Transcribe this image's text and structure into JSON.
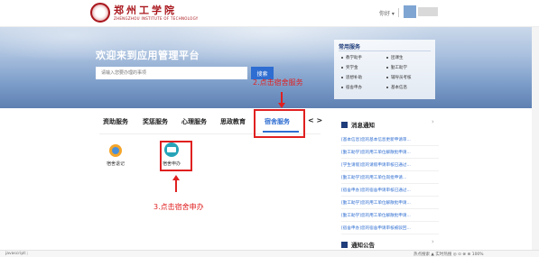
{
  "header": {
    "logo_cn": "郑州工学院",
    "logo_en": "ZHENGZHOU INSTITUTE OF TECHNOLOGY",
    "user_label": "你好 ▾"
  },
  "banner": {
    "title": "欢迎来到应用管理平台",
    "search_placeholder": "请输入您要办理的事项",
    "search_button": "搜索"
  },
  "quick": {
    "title": "常用服务",
    "items": [
      "教学助手",
      "团课生",
      "奖学金",
      "勤工助学",
      "思想补助",
      "辅导员考核",
      "宿舍申办",
      "基本信息"
    ]
  },
  "annotations": {
    "step2": "2.点击宿舍服务",
    "step3": "3.点击宿舍申办"
  },
  "tabs": {
    "items": [
      "资助服务",
      "奖惩服务",
      "心理服务",
      "思政教育",
      "宿舍服务"
    ],
    "active_index": 4,
    "arrows": "< >"
  },
  "services": [
    {
      "label": "宿舍退记"
    },
    {
      "label": "宿舍申办"
    }
  ],
  "notice": {
    "title": "消息通知",
    "more": "›",
    "items": [
      "[基本信息]您的基本信息更新申请审...",
      "[勤工助学]您的用工单位解散批申请...",
      "[学生请假]您的请假申请审核已通过...",
      "[勤工助学]您的用工单位岗批申请...",
      "[宿舍申办]您的宿舍申请审核已通过...",
      "[勤工助学]您的用工单位解散批申请...",
      "[勤工助学]您的用工单位解散批申请...",
      "[宿舍申办]您的宿舍申请审核被驳回..."
    ]
  },
  "announce": {
    "title": "通知公告",
    "more": "›"
  },
  "status": {
    "left": "javascript:;",
    "right": "热点搜索   ▲ 实时热搜   ◎   ⊙   ⊗   ⊕ 100%"
  },
  "colors": {
    "brand_red": "#a9171d",
    "accent_blue": "#2e6dd1",
    "annotation_red": "#e02020"
  }
}
